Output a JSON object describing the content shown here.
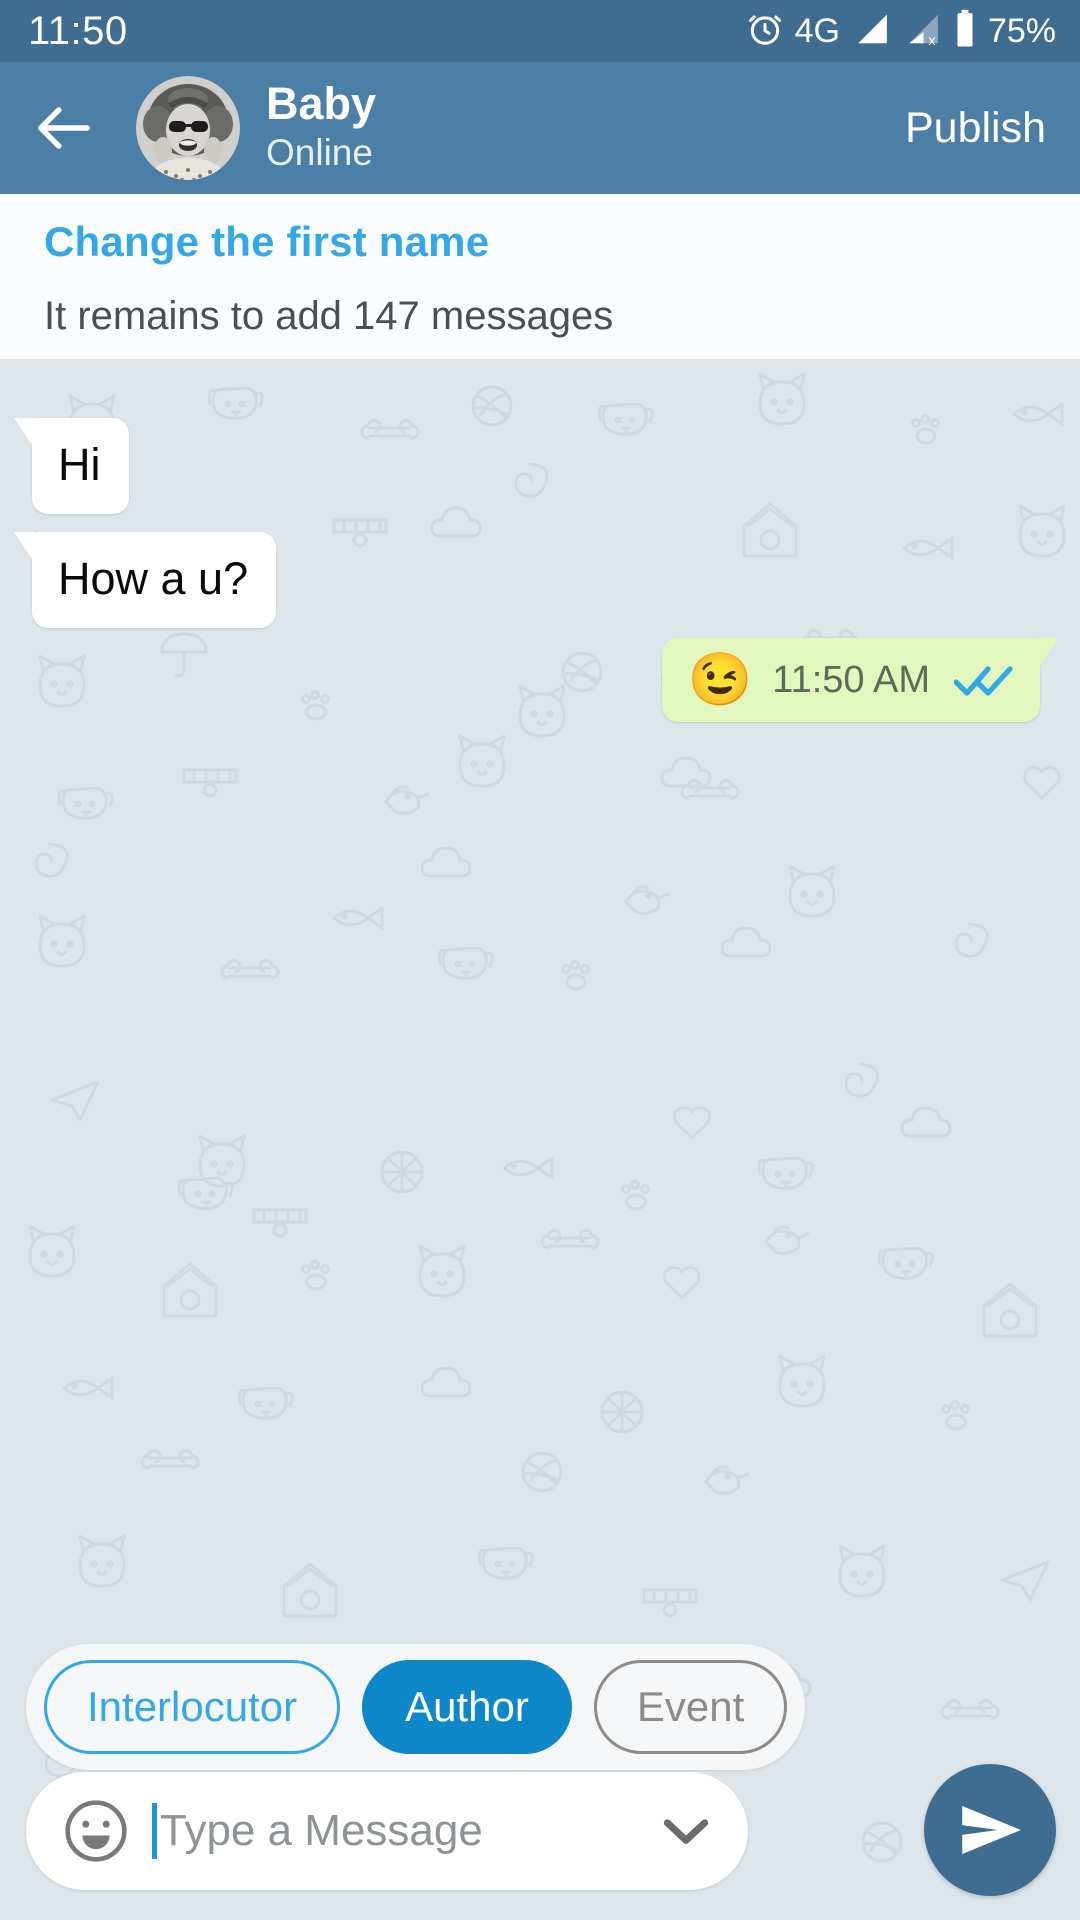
{
  "statusbar": {
    "time": "11:50",
    "network": "4G",
    "battery": "75%",
    "icons": [
      "alarm-clock-icon",
      "signal-bars-icon",
      "signal-bars-no-service-icon",
      "battery-icon"
    ]
  },
  "header": {
    "back_icon": "arrow-left-icon",
    "avatar": "contact-avatar",
    "name": "Baby",
    "status": "Online",
    "publish_label": "Publish"
  },
  "info": {
    "title": "Change the first name",
    "subtitle": "It remains to add 147 messages"
  },
  "chat": {
    "messages": [
      {
        "id": "msg-1",
        "direction": "in",
        "text": "Hi"
      },
      {
        "id": "msg-2",
        "direction": "in",
        "text": "How a u?"
      },
      {
        "id": "msg-3",
        "direction": "out",
        "emoji": "😉",
        "time": "11:50 AM",
        "status_icon": "double-check-icon"
      }
    ]
  },
  "filters": {
    "options": [
      {
        "label": "Interlocutor",
        "state": "outline-blue"
      },
      {
        "label": "Author",
        "state": "selected"
      },
      {
        "label": "Event",
        "state": "outline-gray"
      }
    ]
  },
  "composer": {
    "emoji_icon": "smiley-face-icon",
    "placeholder": "Type a Message",
    "value": "",
    "expand_icon": "chevron-down-icon",
    "send_icon": "send-paper-plane-icon"
  },
  "colors": {
    "status_bar": "#3f6d92",
    "header": "#4b7fa6",
    "accent_cyan": "#33a8e8",
    "accent_blue": "#0e87c9",
    "chat_bg": "#dee5ea",
    "bubble_in": "#ffffff",
    "bubble_out": "#e2f7bd",
    "tick_blue": "#33a8e8",
    "send_btn": "#3f6d92"
  }
}
